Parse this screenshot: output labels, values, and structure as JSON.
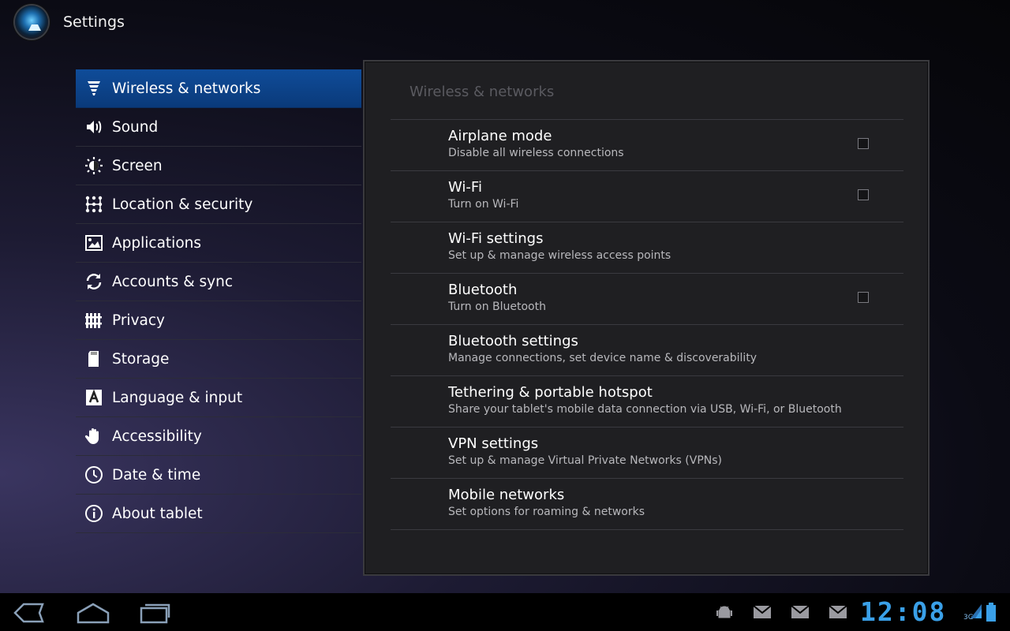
{
  "app": {
    "title": "Settings"
  },
  "sidebar": {
    "items": [
      {
        "label": "Wireless & networks",
        "icon": "wireless-icon",
        "selected": true
      },
      {
        "label": "Sound",
        "icon": "speaker-icon"
      },
      {
        "label": "Screen",
        "icon": "brightness-icon"
      },
      {
        "label": "Location & security",
        "icon": "lock-pattern-icon"
      },
      {
        "label": "Applications",
        "icon": "applications-icon"
      },
      {
        "label": "Accounts & sync",
        "icon": "sync-icon"
      },
      {
        "label": "Privacy",
        "icon": "fence-icon"
      },
      {
        "label": "Storage",
        "icon": "sd-card-icon"
      },
      {
        "label": "Language & input",
        "icon": "language-icon"
      },
      {
        "label": "Accessibility",
        "icon": "hand-icon"
      },
      {
        "label": "Date & time",
        "icon": "clock-icon"
      },
      {
        "label": "About tablet",
        "icon": "info-icon"
      }
    ]
  },
  "panel": {
    "title": "Wireless & networks",
    "prefs": [
      {
        "title": "Airplane mode",
        "summary": "Disable all wireless connections",
        "checkbox": true,
        "checked": false
      },
      {
        "title": "Wi-Fi",
        "summary": "Turn on Wi-Fi",
        "checkbox": true,
        "checked": false
      },
      {
        "title": "Wi-Fi settings",
        "summary": "Set up & manage wireless access points",
        "checkbox": false
      },
      {
        "title": "Bluetooth",
        "summary": "Turn on Bluetooth",
        "checkbox": true,
        "checked": false
      },
      {
        "title": "Bluetooth settings",
        "summary": "Manage connections, set device name & discoverability",
        "checkbox": false
      },
      {
        "title": "Tethering & portable hotspot",
        "summary": "Share your tablet's mobile data connection via USB, Wi-Fi, or Bluetooth",
        "checkbox": false
      },
      {
        "title": "VPN settings",
        "summary": "Set up & manage Virtual Private Networks (VPNs)",
        "checkbox": false
      },
      {
        "title": "Mobile networks",
        "summary": "Set options for roaming & networks",
        "checkbox": false
      }
    ]
  },
  "systembar": {
    "clock": "12:08",
    "network": "3G",
    "nav": [
      "back-icon",
      "home-icon",
      "recent-apps-icon"
    ],
    "notifications": [
      "android-debug-icon",
      "gmail-icon",
      "gmail-icon",
      "gmail-icon"
    ],
    "accent_color": "#3aa0e8"
  },
  "colors": {
    "selected_bg": "#0f4c99",
    "panel_bg": "#1f1f22"
  }
}
